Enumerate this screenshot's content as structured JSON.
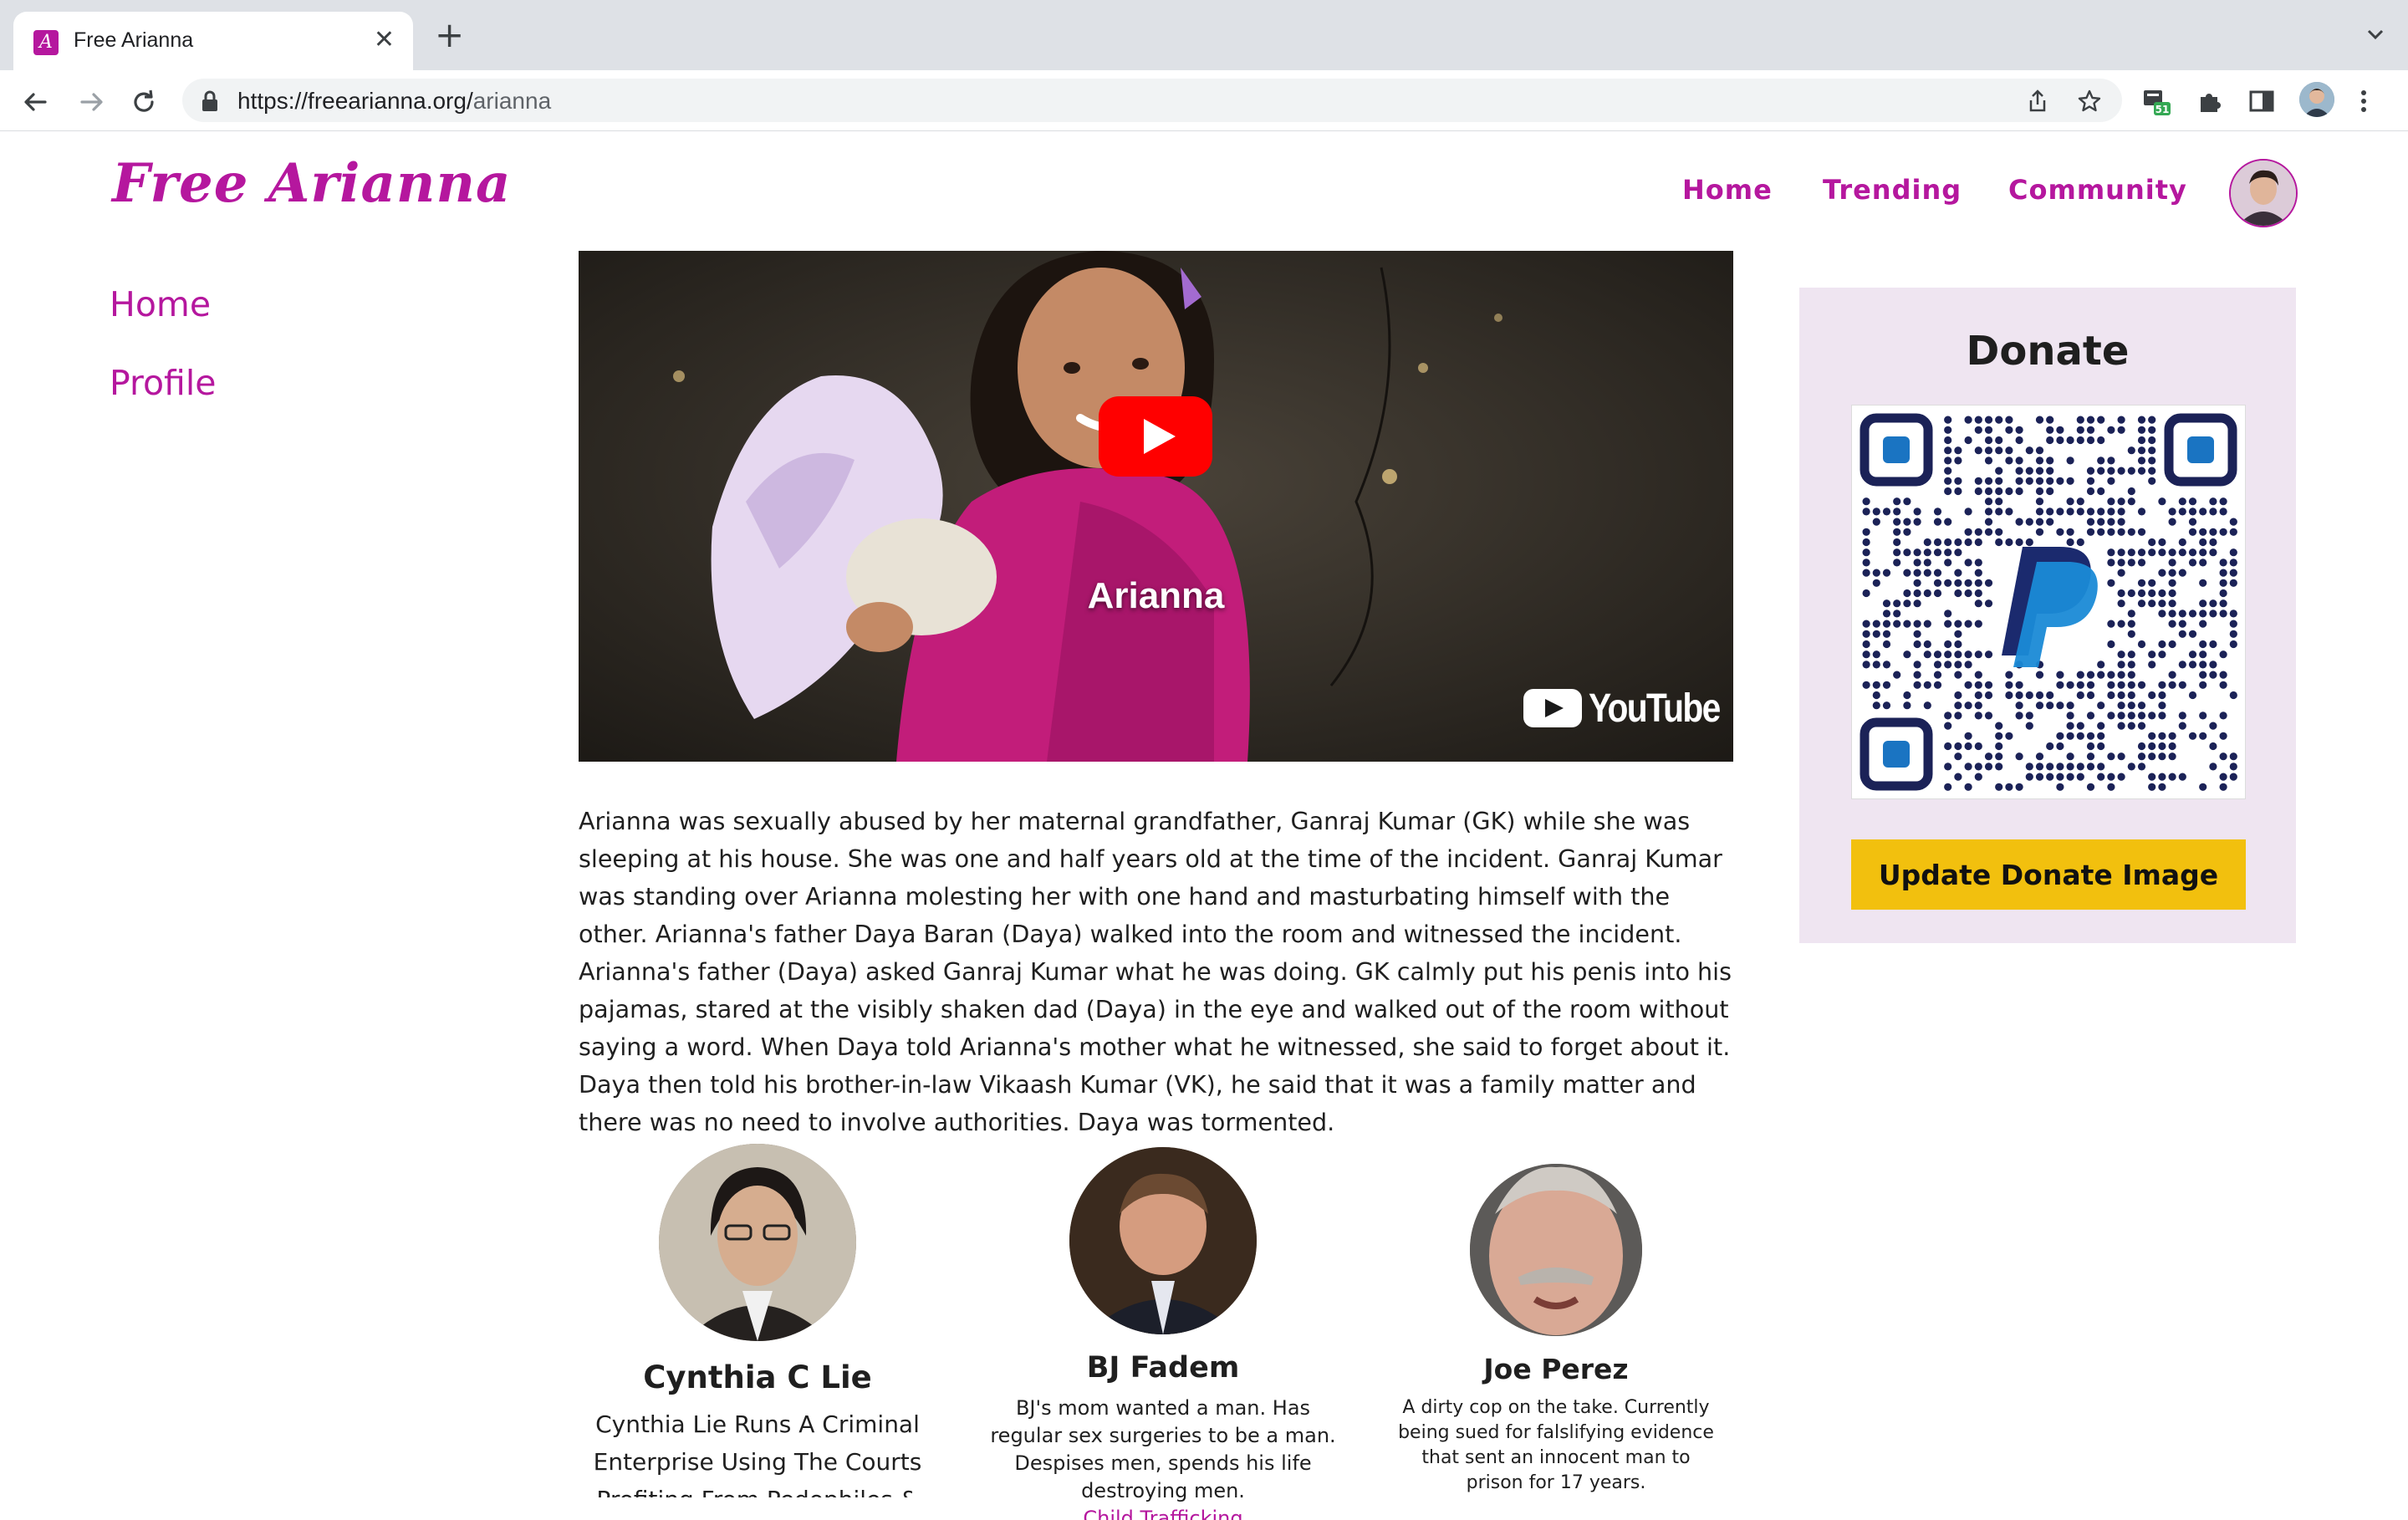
{
  "browser": {
    "tab_title": "Free Arianna",
    "url_host": "https://freearianna.org/",
    "url_path": "arianna",
    "extension_badge": "51"
  },
  "site": {
    "logo": "Free Arianna",
    "brand_color": "#b5179e",
    "top_nav": [
      "Home",
      "Trending",
      "Community"
    ],
    "side_nav": [
      "Home",
      "Profile"
    ]
  },
  "video": {
    "caption": "Arianna",
    "provider": "YouTube"
  },
  "story": "Arianna was sexually abused by her maternal grandfather, Ganraj Kumar (GK) while she was sleeping at his house. She was one and half years old at the time of the incident. Ganraj Kumar was standing over Arianna molesting her with one hand and masturbating himself with the other. Arianna's father Daya Baran (Daya) walked into the room and witnessed the incident. Arianna's father (Daya) asked Ganraj Kumar what he was doing. GK calmly put his penis into his pajamas, stared at the visibly shaken dad (Daya) in the eye and walked out of the room without saying a word. When Daya told Arianna's mother what he witnessed, she said to forget about it. Daya then told his brother-in-law Vikaash Kumar (VK), he said that it was a family matter and there was no need to involve authorities. Daya was tormented.",
  "donate": {
    "title": "Donate",
    "button": "Update Donate Image",
    "button_color": "#f2c00e"
  },
  "people": [
    {
      "name": "Cynthia C Lie",
      "desc": "Cynthia Lie Runs A Criminal Enterprise Using The Courts",
      "desc_cut": "Profiting From Pedophiles &"
    },
    {
      "name": "BJ Fadem",
      "desc": "BJ's mom wanted a man. Has regular sex surgeries to be a man. Despises men, spends his life destroying men.",
      "link": "Child Trafficking"
    },
    {
      "name": "Joe Perez",
      "desc": "A dirty cop on the take. Currently being sued for falslifying evidence that sent an innocent man to prison for 17 years."
    }
  ]
}
